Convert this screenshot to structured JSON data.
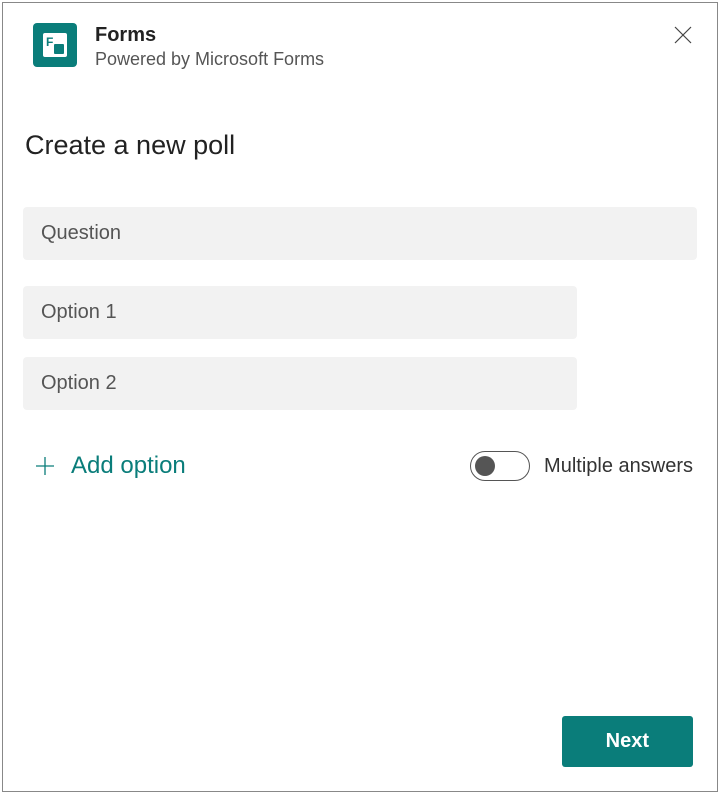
{
  "header": {
    "app_title": "Forms",
    "app_subtitle": "Powered by Microsoft Forms"
  },
  "page": {
    "title": "Create a new poll"
  },
  "form": {
    "question_placeholder": "Question",
    "options": [
      {
        "placeholder": "Option 1"
      },
      {
        "placeholder": "Option 2"
      }
    ],
    "add_option_label": "Add option",
    "multiple_answers_label": "Multiple answers",
    "multiple_answers_on": false
  },
  "footer": {
    "next_label": "Next"
  },
  "colors": {
    "accent": "#0a7d7a",
    "field_bg": "#f2f2f2"
  }
}
